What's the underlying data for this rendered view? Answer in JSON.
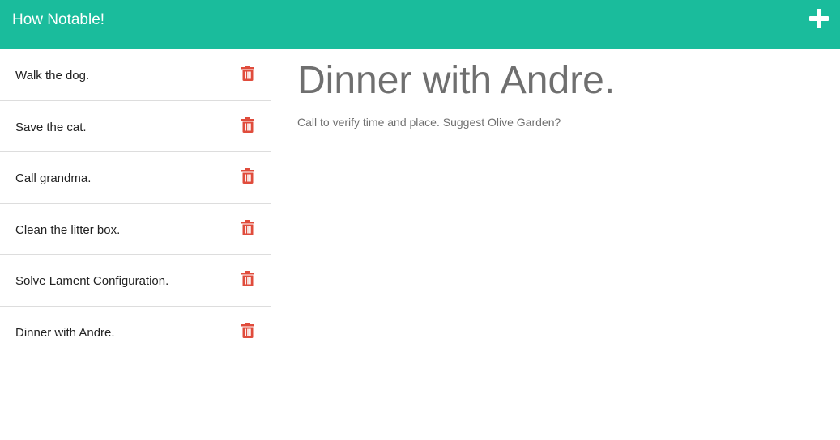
{
  "header": {
    "title": "How Notable!",
    "add_icon": "plus-icon",
    "color": "#1abc9c"
  },
  "sidebar": {
    "items": [
      {
        "label": "Walk the dog.",
        "icon": "trash-icon"
      },
      {
        "label": "Save the cat.",
        "icon": "trash-icon"
      },
      {
        "label": "Call grandma.",
        "icon": "trash-icon"
      },
      {
        "label": "Clean the litter box.",
        "icon": "trash-icon"
      },
      {
        "label": "Solve Lament Configuration.",
        "icon": "trash-icon"
      },
      {
        "label": "Dinner with Andre.",
        "icon": "trash-icon"
      }
    ],
    "trash_color": "#e04c3c"
  },
  "main": {
    "title": "Dinner with Andre.",
    "text": "Call to verify time and place. Suggest Olive Garden?"
  }
}
